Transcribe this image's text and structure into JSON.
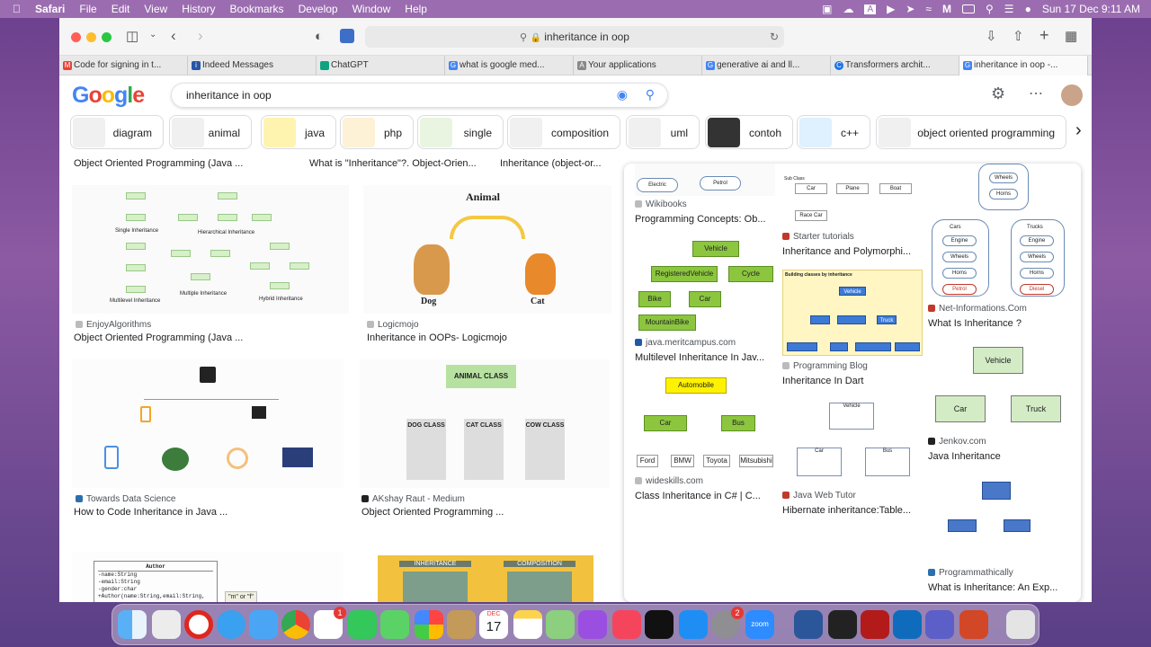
{
  "menubar": {
    "app": "Safari",
    "items": [
      "File",
      "Edit",
      "View",
      "History",
      "Bookmarks",
      "Develop",
      "Window",
      "Help"
    ],
    "datetime": "Sun 17 Dec  9:11 AM"
  },
  "browser": {
    "address": "inheritance in oop"
  },
  "tabs": [
    {
      "label": "Code for signing in t...",
      "icon": "gmail-icon"
    },
    {
      "label": "Indeed Messages",
      "icon": "info-icon"
    },
    {
      "label": "ChatGPT",
      "icon": "chatgpt-icon"
    },
    {
      "label": "what is google med...",
      "icon": "google-icon"
    },
    {
      "label": "Your applications",
      "icon": "app-icon"
    },
    {
      "label": "generative ai and ll...",
      "icon": "google-icon"
    },
    {
      "label": "Transformers archit...",
      "icon": "transformers-icon"
    },
    {
      "label": "inheritance in oop -...",
      "icon": "google-icon"
    }
  ],
  "google": {
    "logo": "Google",
    "query": "inheritance in oop"
  },
  "chips": [
    "diagram",
    "animal",
    "java",
    "php",
    "single",
    "composition",
    "uml",
    "contoh",
    "c++",
    "object oriented programming"
  ],
  "top_titles": [
    "Object Oriented Programming (Java ...",
    "What is \"Inheritance\"?. Object-Orien...",
    "Inheritance (object-or..."
  ],
  "results": [
    {
      "source": "EnjoyAlgorithms",
      "title": "Object Oriented Programming (Java ..."
    },
    {
      "source": "Logicmojo",
      "title": "Inheritance in OOPs- Logicmojo"
    },
    {
      "source": "Towards Data Science",
      "title": "How to Code Inheritance in Java ..."
    },
    {
      "source": "AKshay Raut - Medium",
      "title": "Object Oriented Programming ..."
    }
  ],
  "img_text": {
    "animal_title": "Animal",
    "dog": "Dog",
    "cat": "Cat",
    "animal_class": "ANIMAL CLASS",
    "dog_class": "DOG CLASS",
    "cat_class": "CAT CLASS",
    "cow_class": "COW CLASS",
    "author": "Author",
    "author_lines": [
      "-name:String",
      "-email:String",
      "-gender:char",
      "+Author(name:String,email:String,"
    ],
    "mf": "\"m\" or \"f\"",
    "inheritance": "INHERITANCE",
    "composition": "COMPOSITION",
    "single_inh": "Single Inheritance",
    "hier_inh": "Hierarchical Inheritance",
    "multilevel_inh": "Multilevel Inheritance",
    "multiple_inh": "Multiple Inheritance",
    "hybrid_inh": "Hybrid Inheritance"
  },
  "panel": {
    "close_icon": "close-icon",
    "items": [
      {
        "source": "Wikibooks",
        "title": "Programming Concepts: Ob..."
      },
      {
        "source": "Starter tutorials",
        "title": "Inheritance and Polymorphi..."
      },
      {
        "source": "Net-Informations.Com",
        "title": "What Is Inheritance ?"
      },
      {
        "source": "java.meritcampus.com",
        "title": "Multilevel Inheritance In Jav..."
      },
      {
        "source": "Programming Blog",
        "title": "Inheritance In Dart"
      },
      {
        "source": "Jenkov.com",
        "title": "Java Inheritance"
      },
      {
        "source": "wideskills.com",
        "title": "Class Inheritance in C# | C..."
      },
      {
        "source": "Java Web Tutor",
        "title": "Hibernate inheritance:Table..."
      },
      {
        "source": "Programmathically",
        "title": "What is Inheritance: An Exp..."
      }
    ],
    "img_text": {
      "electric": "Electric",
      "petrol": "Petrol",
      "vehicle": "Vehicle",
      "registered": "RegisteredVehicle",
      "cycle": "Cycle",
      "bike": "Bike",
      "car": "Car",
      "mountain": "MountainBike",
      "automobile": "Automobile",
      "bus": "Bus",
      "ford": "Ford",
      "bmw": "BMW",
      "toyota": "Toyota",
      "mitsubishi": "Mitsubishi",
      "truck": "Truck",
      "building": "Building classes by inheritance",
      "subclass": "Sub Class",
      "plane": "Plane",
      "boat": "Boat",
      "racecar": "Race Car",
      "cars": "Cars",
      "trucks": "Trucks",
      "engine": "Engine",
      "wheels": "Wheels",
      "horns": "Horns",
      "petrol2": "Petrol",
      "diesel": "Diesel"
    }
  },
  "dock": {
    "calendar_month": "DEC",
    "calendar_day": "17",
    "zoom": "zoom",
    "badge_reminders": "1",
    "badge_settings": "2"
  }
}
